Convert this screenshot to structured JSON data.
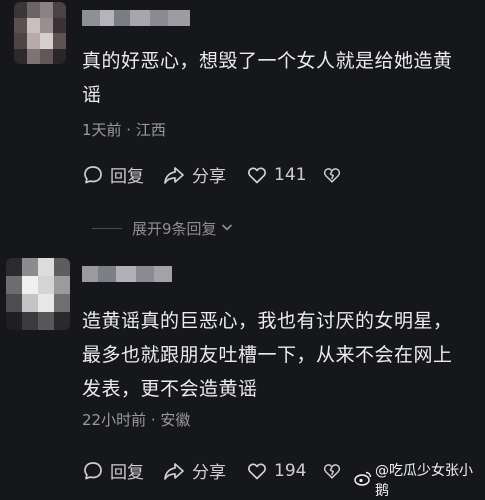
{
  "comments": [
    {
      "text": "真的好恶心，想毁了一个女人就是给她造黄谣",
      "line1": "真的好恶心，想毁了一个女人就是给她造黄",
      "line2": "谣",
      "meta": "1天前 · 江西",
      "reply_label": "回复",
      "share_label": "分享",
      "likes": "141"
    },
    {
      "text": "造黄谣真的巨恶心，我也有讨厌的女明星，最多也就跟朋友吐槽一下，从来不会在网上发表，更不会造黄谣",
      "line1": "造黄谣真的巨恶心，我也有讨厌的女明星，",
      "line2": "最多也就跟朋友吐槽一下，从来不会在网上",
      "line3": "发表，更不会造黄谣",
      "meta": "22小时前 · 安徽",
      "reply_label": "回复",
      "share_label": "分享",
      "likes": "194"
    }
  ],
  "expand_replies": "展开9条回复",
  "watermark": "@吃瓜少女张小鹅",
  "icons": {
    "reply": "comment-bubble-icon",
    "share": "share-arrow-icon",
    "like": "heart-icon",
    "dislike": "broken-heart-icon",
    "expand": "chevron-down-icon",
    "watermark": "weibo-logo-icon"
  }
}
